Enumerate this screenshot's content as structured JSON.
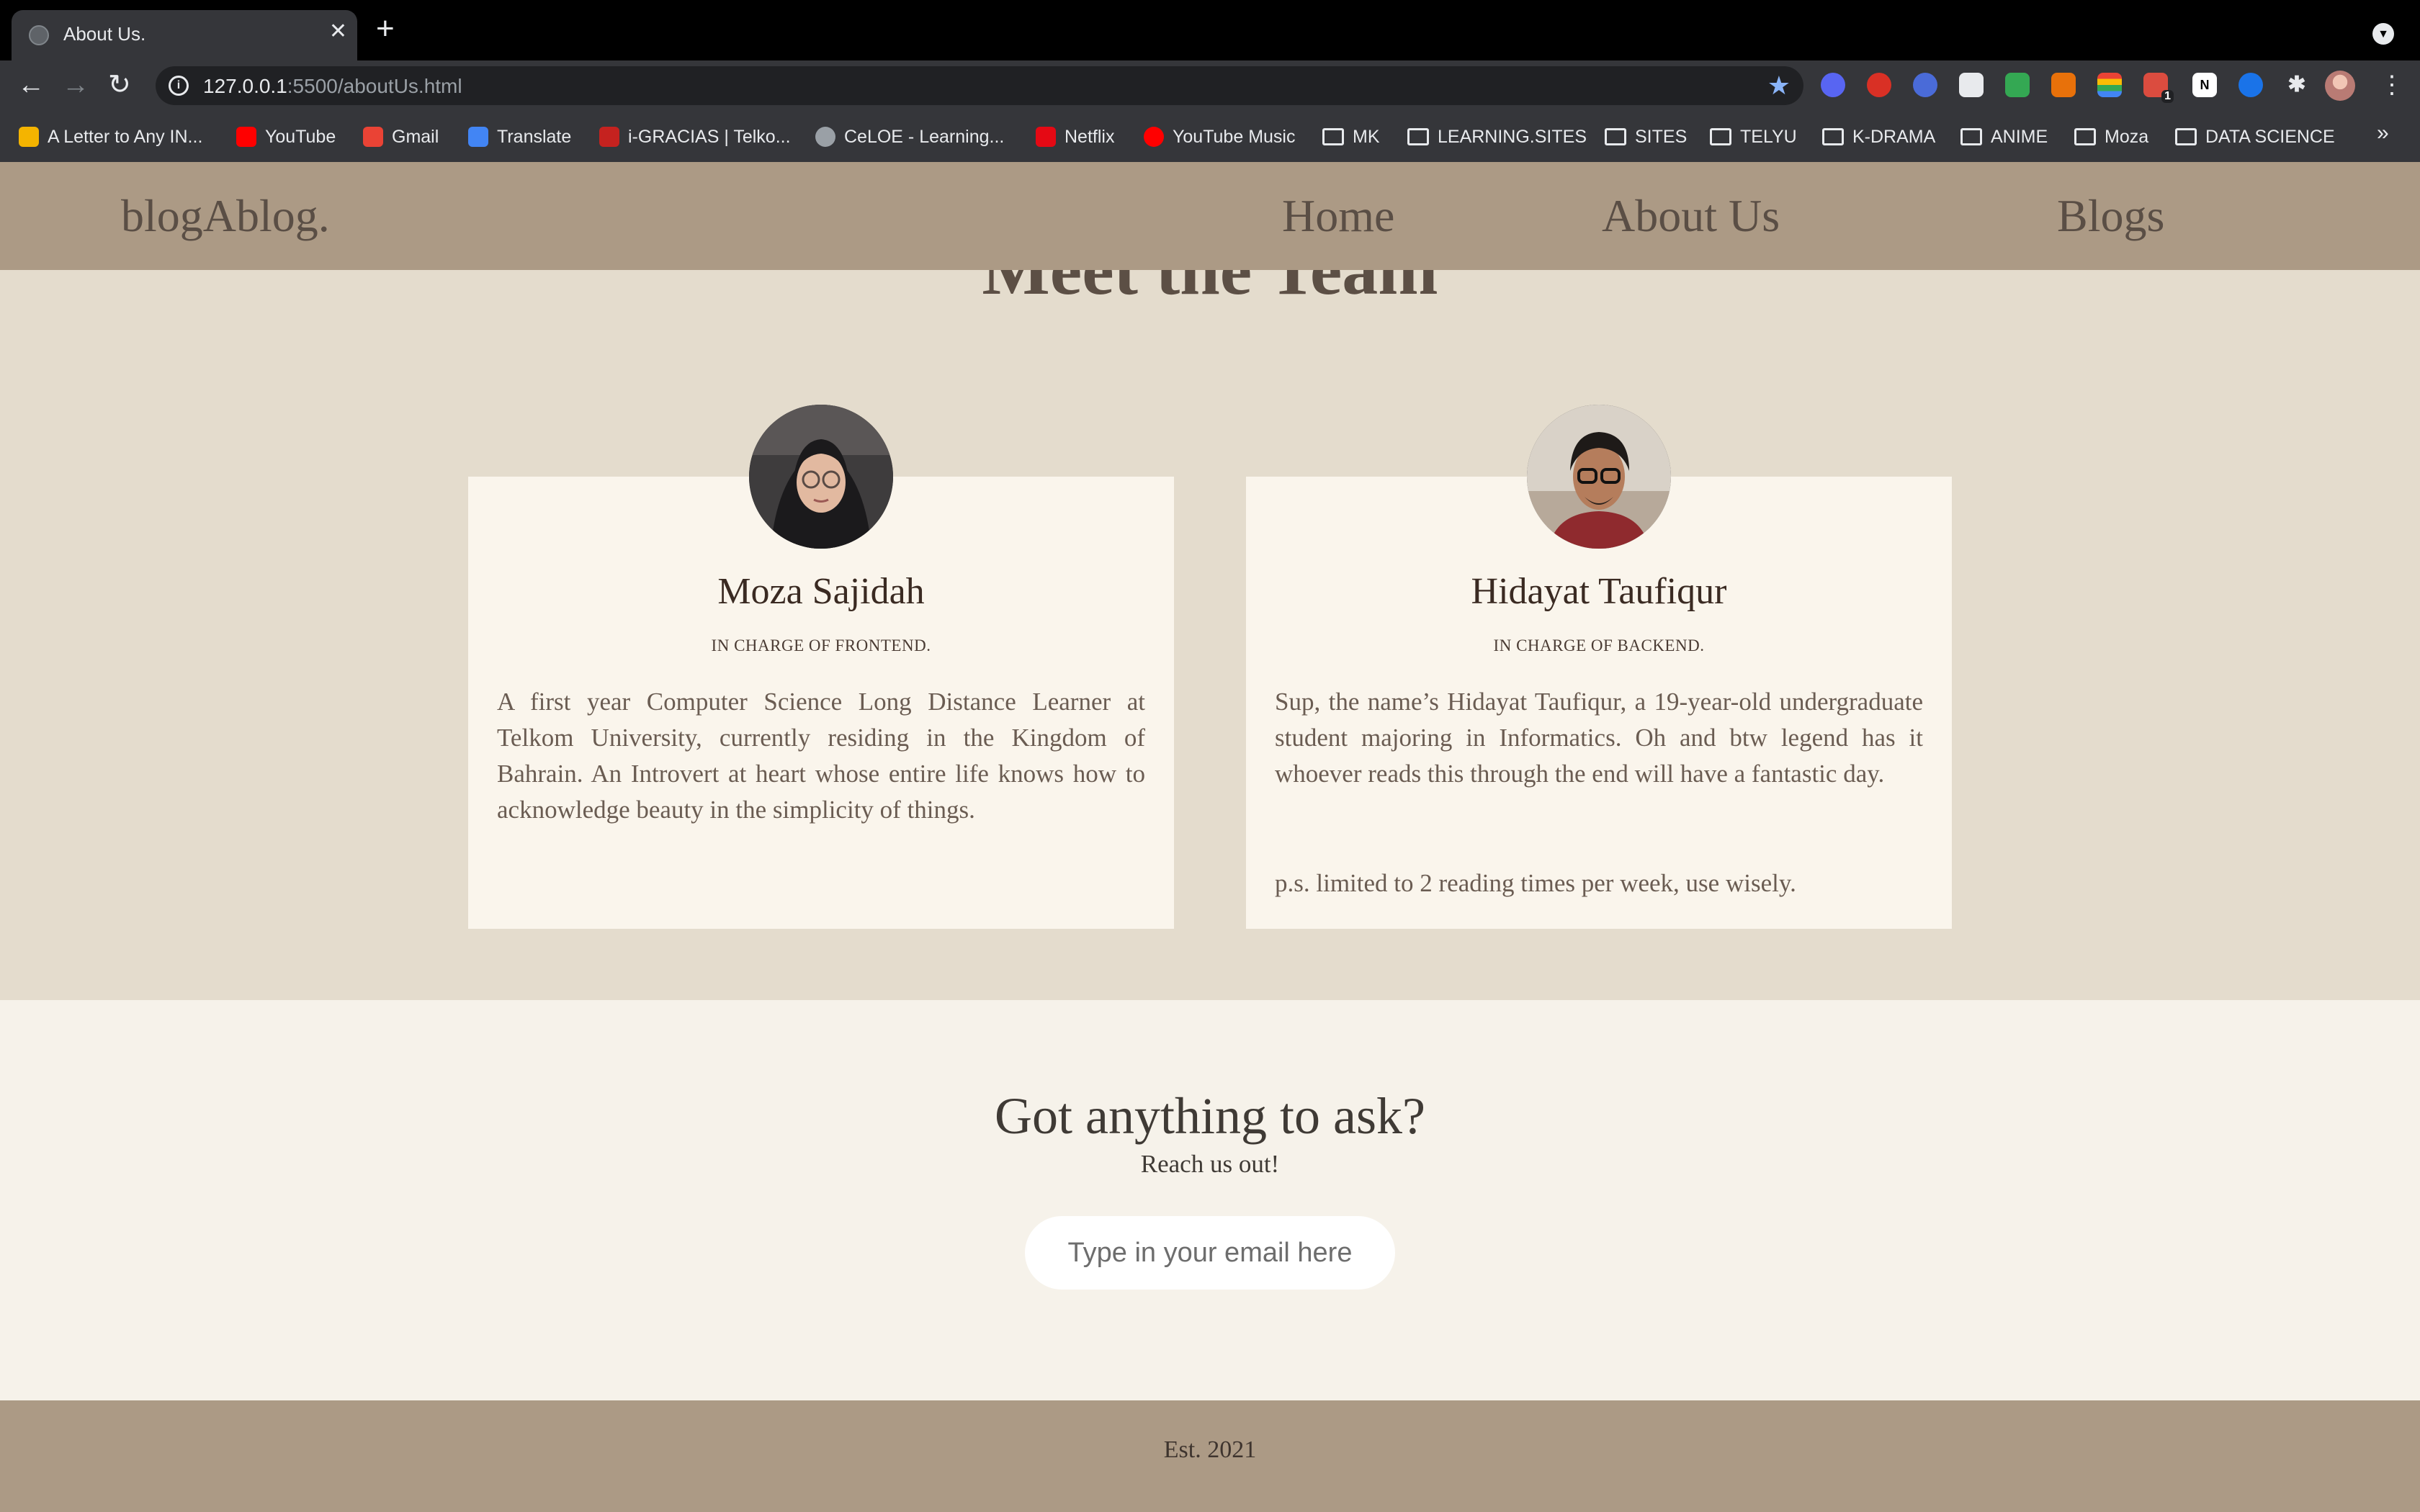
{
  "browser": {
    "tab_title": "About Us.",
    "new_tab_label": "+",
    "url_host": "127.0.0.1",
    "url_rest": ":5500/aboutUs.html",
    "extension_badge": "1",
    "bookmarks": [
      "A Letter to Any IN...",
      "YouTube",
      "Gmail",
      "Translate",
      "i-GRACIAS | Telko...",
      "CeLOE - Learning...",
      "Netflix",
      "YouTube Music",
      "MK",
      "LEARNING.SITES",
      "SITES",
      "TELYU",
      "K-DRAMA",
      "ANIME",
      "Moza",
      "DATA SCIENCE"
    ],
    "bookmarks_more": "»"
  },
  "site": {
    "logo": "blogAblog.",
    "nav": [
      "Home",
      "About Us",
      "Blogs"
    ]
  },
  "team": {
    "title": "Meet the Team",
    "members": [
      {
        "name": "Moza Sajidah",
        "role": "IN CHARGE OF FRONTEND.",
        "bio": "A first year Computer Science Long Distance Learner at Telkom University, currently residing in the Kingdom of Bahrain. An Introvert at heart whose entire life knows how to acknowledge beauty in the simplicity of things.",
        "ps": ""
      },
      {
        "name": "Hidayat Taufiqur",
        "role": "IN CHARGE OF BACKEND.",
        "bio": "Sup, the name’s Hidayat Taufiqur, a 19-year-old undergraduate student majoring in Informatics. Oh and btw legend has it whoever reads this through the end will have a fantastic day.",
        "ps": "p.s. limited to 2 reading times per week, use wisely."
      }
    ]
  },
  "contact": {
    "title": "Got anything to ask?",
    "subtitle": "Reach us out!",
    "email_placeholder": "Type in your email here"
  },
  "footer": {
    "text": "Est. 2021"
  },
  "colors": {
    "nav_bg": "#ac9a85",
    "page_bg": "#e4dccd",
    "card_bg": "#faf5ec",
    "contact_bg": "#f6f2ea"
  }
}
